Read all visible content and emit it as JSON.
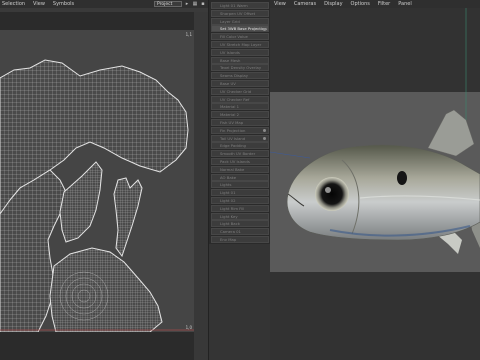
{
  "left_menu": {
    "items": [
      "Selection",
      "View",
      "Symbols"
    ]
  },
  "project_select": {
    "value": "Project"
  },
  "uv_corners": {
    "top_right": "1,1",
    "bottom_right": "1,0"
  },
  "panel": {
    "items": [
      {
        "label": "Light 01 Warm",
        "active": false,
        "dot": false
      },
      {
        "label": "Sharpen UV Offset",
        "active": false,
        "dot": false
      },
      {
        "label": "Layer Grid",
        "active": false,
        "dot": false
      },
      {
        "label": "Set 3WB Base Projection",
        "active": true,
        "dot": true
      },
      {
        "label": "Fill Color Value",
        "active": false,
        "dot": false
      },
      {
        "label": "UV Stretch Map Layer",
        "active": false,
        "dot": false
      },
      {
        "label": "UV Islands",
        "active": false,
        "dot": false
      },
      {
        "label": "Base Mesh",
        "active": false,
        "dot": false
      },
      {
        "label": "Texel Density Overlay",
        "active": false,
        "dot": false
      },
      {
        "label": "Seams Display",
        "active": false,
        "dot": false
      },
      {
        "label": "Base UV",
        "active": false,
        "dot": false
      },
      {
        "label": "UV Checker Grid",
        "active": false,
        "dot": false
      },
      {
        "label": "UV Checker Ref",
        "active": false,
        "dot": false
      },
      {
        "label": "Material 1",
        "active": false,
        "dot": false
      },
      {
        "label": "Material 2",
        "active": false,
        "dot": false
      },
      {
        "label": "Fish UV Map",
        "active": false,
        "dot": false
      },
      {
        "label": "Fin Projection",
        "active": false,
        "dot": true
      },
      {
        "label": "Tail UV Island",
        "active": false,
        "dot": true
      },
      {
        "label": "Edge Padding",
        "active": false,
        "dot": false
      },
      {
        "label": "Smooth UV Border",
        "active": false,
        "dot": false
      },
      {
        "label": "Pack UV Islands",
        "active": false,
        "dot": false
      },
      {
        "label": "Normal Bake",
        "active": false,
        "dot": false
      },
      {
        "label": "AO Bake",
        "active": false,
        "dot": false
      },
      {
        "label": "Lights",
        "active": false,
        "dot": false
      },
      {
        "label": "Light 01",
        "active": false,
        "dot": false
      },
      {
        "label": "Light 02",
        "active": false,
        "dot": false
      },
      {
        "label": "Light Rim Fill",
        "active": false,
        "dot": false
      },
      {
        "label": "Light Key",
        "active": false,
        "dot": false
      },
      {
        "label": "Light Back",
        "active": false,
        "dot": false
      },
      {
        "label": "Camera 01",
        "active": false,
        "dot": false
      },
      {
        "label": "Env Map",
        "active": false,
        "dot": false
      }
    ]
  },
  "right_menu": {
    "items": [
      "View",
      "Cameras",
      "Display",
      "Options",
      "Filter",
      "Panel"
    ]
  }
}
